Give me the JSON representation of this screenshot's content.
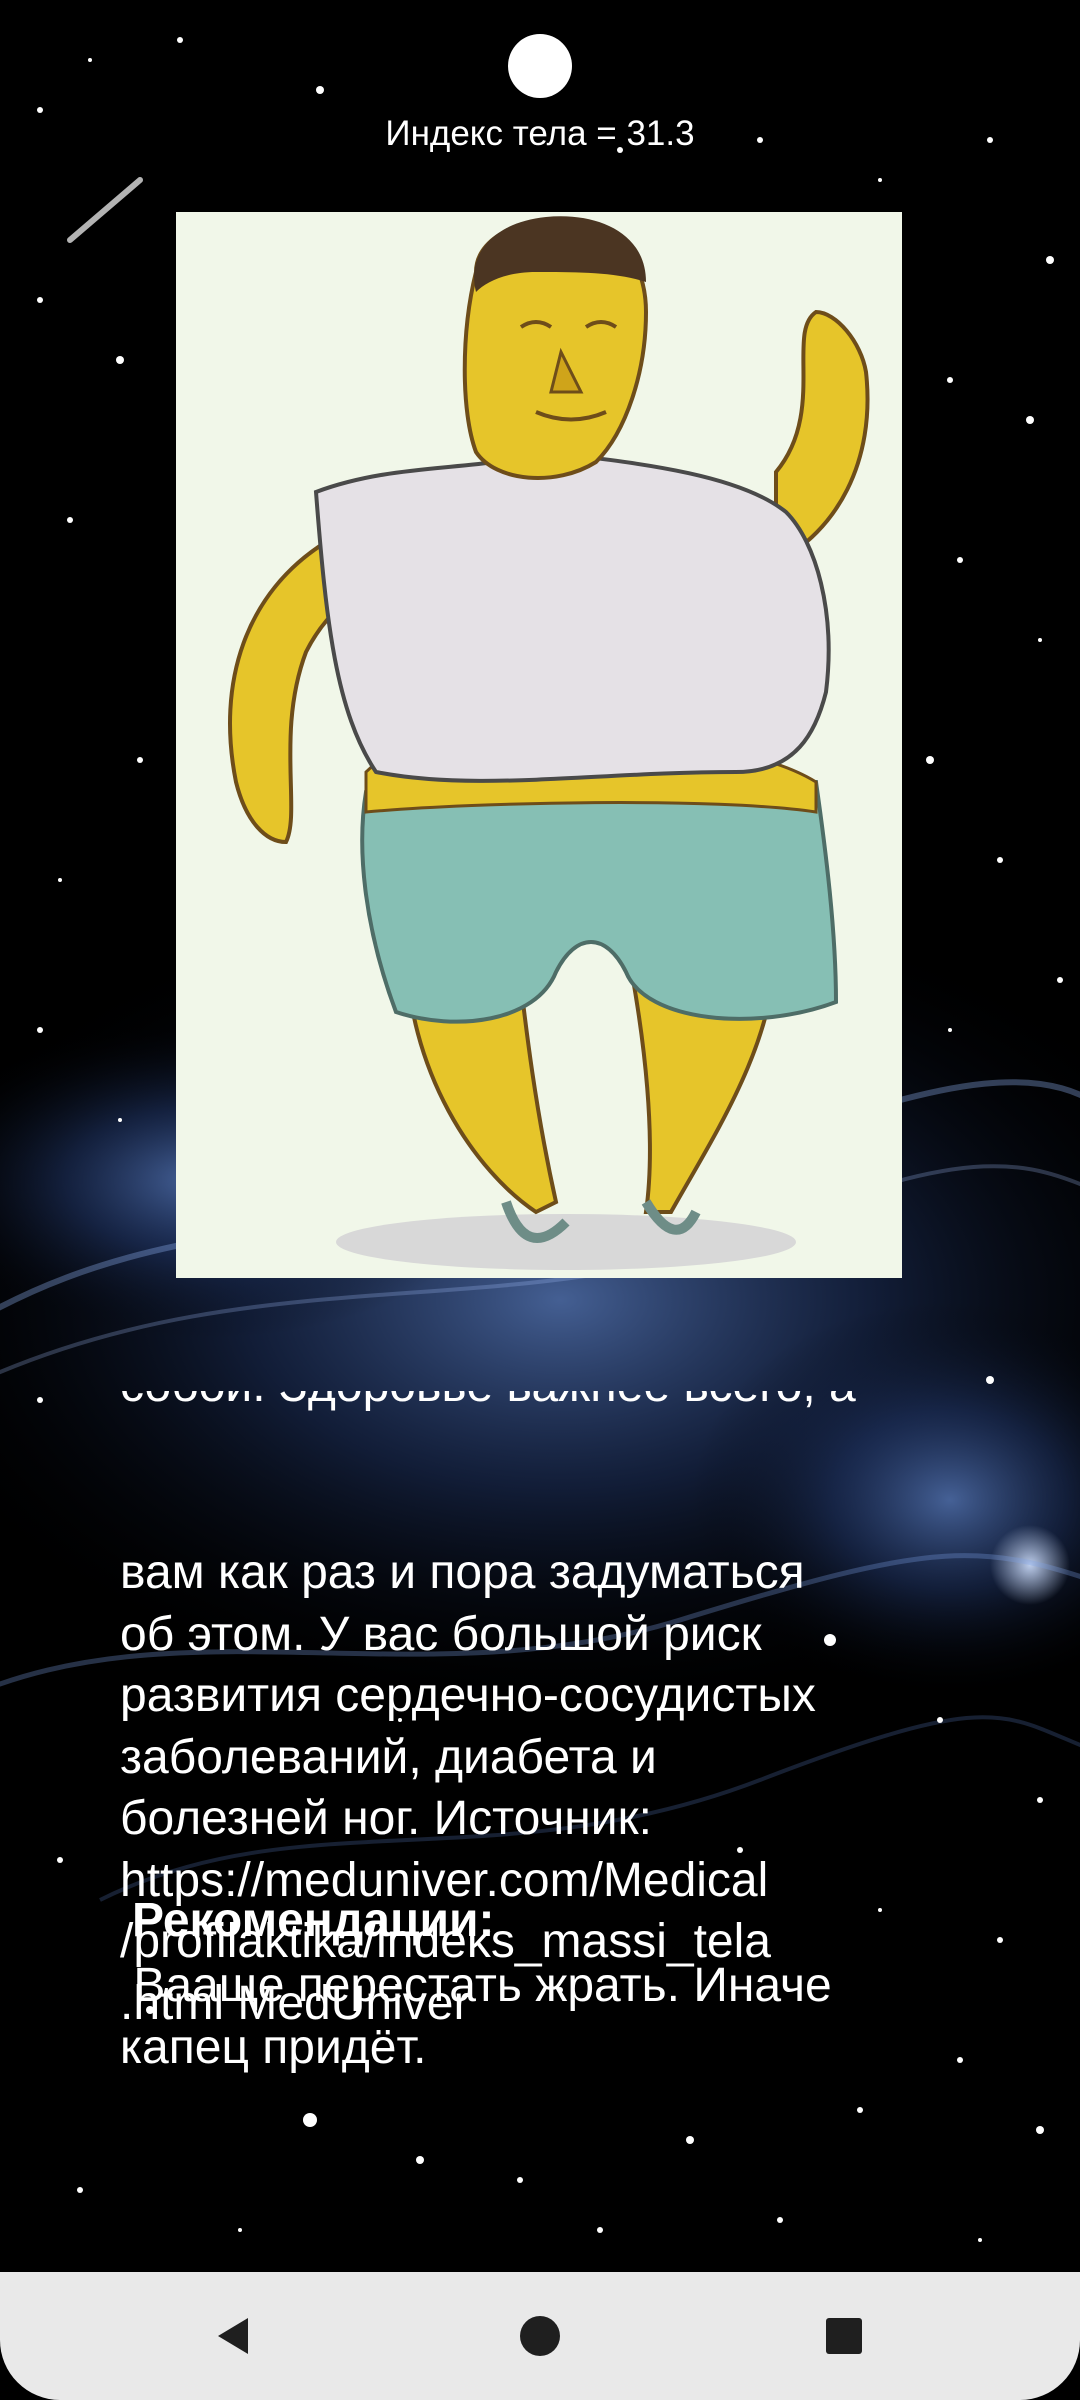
{
  "header": {
    "bmi_label": "Индекс тела = 31.3"
  },
  "illustration": {
    "icon": "overweight-man-illustration"
  },
  "description": {
    "clipped_line": "собой. Здоровье важнее всего, а",
    "text": "вам как раз и пора задуматься\nоб этом. У вас большой риск\nразвития сердечно-сосудистых\nзаболеваний, диабета и\nболезней ног. Источник:\nhttps://meduniver.com/Medical\n/profilaktika/indeks_massi_tela\n.html MedUniver"
  },
  "recommendations": {
    "heading": "Рекомендации:",
    "text": " Вааще перестать жрать. Иначе\nкапец придёт."
  },
  "navbar": {
    "back_icon": "back-triangle-icon",
    "home_icon": "home-circle-icon",
    "recents_icon": "recents-square-icon"
  },
  "colors": {
    "background": "#000000",
    "text": "#ffffff",
    "navbar": "#e9e9e9",
    "illustration_bg": "#f1f7e9"
  }
}
